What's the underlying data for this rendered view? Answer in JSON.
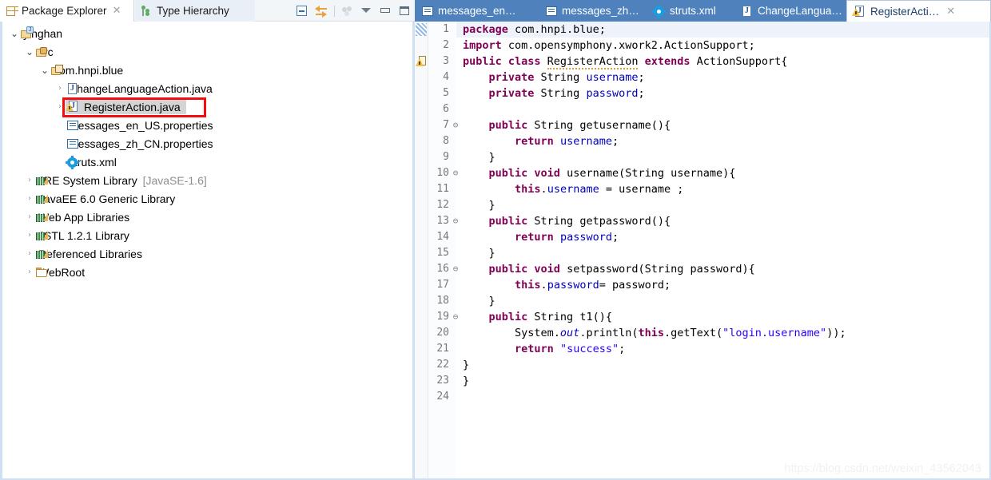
{
  "left_view": {
    "tabs": [
      {
        "label": "Package Explorer",
        "icon": "package-explorer-icon",
        "active": true,
        "close": "✕"
      },
      {
        "label": "Type Hierarchy",
        "icon": "type-hierarchy-icon",
        "active": false
      }
    ],
    "toolbar": [
      {
        "name": "collapse-all-icon",
        "title": "Collapse All"
      },
      {
        "name": "link-with-editor-icon",
        "title": "Link with Editor"
      },
      {
        "name": "view-menu-icon",
        "title": "View Menu"
      },
      {
        "name": "chevron-down-icon",
        "title": "Restore"
      },
      {
        "name": "minimize-icon",
        "title": "Minimize"
      },
      {
        "name": "maximize-icon",
        "title": "Maximize"
      }
    ],
    "tree": [
      {
        "label": "yinghan",
        "icon": "java-project-icon",
        "indent": 0,
        "twisty": "open",
        "selected": false
      },
      {
        "label": "src",
        "icon": "source-folder-icon",
        "indent": 1,
        "twisty": "open",
        "selected": false
      },
      {
        "label": "com.hnpi.blue",
        "icon": "package-icon",
        "indent": 2,
        "twisty": "open",
        "selected": false
      },
      {
        "label": "ChangeLanguageAction.java",
        "icon": "java-file-icon",
        "indent": 3,
        "twisty": "closed",
        "selected": false
      },
      {
        "label": "RegisterAction.java",
        "icon": "java-file-warning-icon",
        "indent": 3,
        "twisty": "closed",
        "selected": true,
        "annotated": true
      },
      {
        "label": "messages_en_US.properties",
        "icon": "properties-file-icon",
        "indent": 3,
        "twisty": "none",
        "selected": false
      },
      {
        "label": "messages_zh_CN.properties",
        "icon": "properties-file-icon",
        "indent": 3,
        "twisty": "none",
        "selected": false
      },
      {
        "label": "struts.xml",
        "icon": "xml-config-icon",
        "indent": 3,
        "twisty": "none",
        "selected": false
      },
      {
        "label": "JRE System Library",
        "suffix": " [JavaSE-1.6]",
        "icon": "library-icon",
        "indent": 1,
        "twisty": "closed",
        "selected": false
      },
      {
        "label": "JavaEE 6.0 Generic Library",
        "icon": "library-icon",
        "indent": 1,
        "twisty": "closed",
        "selected": false
      },
      {
        "label": "Web App Libraries",
        "icon": "library-icon",
        "indent": 1,
        "twisty": "closed",
        "selected": false
      },
      {
        "label": "JSTL 1.2.1 Library",
        "icon": "library-icon",
        "indent": 1,
        "twisty": "closed",
        "selected": false
      },
      {
        "label": "Referenced Libraries",
        "icon": "library-icon",
        "indent": 1,
        "twisty": "closed",
        "selected": false
      },
      {
        "label": "WebRoot",
        "icon": "folder-icon",
        "indent": 1,
        "twisty": "closed",
        "selected": false
      }
    ]
  },
  "editor": {
    "tabs": [
      {
        "label": "messages_en…",
        "icon": "properties-file-icon",
        "active": false
      },
      {
        "label": "messages_zh…",
        "icon": "properties-file-icon",
        "active": false
      },
      {
        "label": "struts.xml",
        "icon": "xml-config-icon",
        "active": false
      },
      {
        "label": "ChangeLangua…",
        "icon": "java-file-icon",
        "active": false
      },
      {
        "label": "RegisterActi…",
        "icon": "java-file-warning-icon",
        "active": true,
        "close": "✕"
      }
    ],
    "lines": [
      {
        "n": "1",
        "fold": "",
        "current": true,
        "marker": "unsaved",
        "tokens": [
          {
            "t": "package ",
            "c": "kw"
          },
          {
            "t": "com.hnpi.blue;",
            "c": ""
          }
        ]
      },
      {
        "n": "2",
        "fold": "",
        "current": false,
        "marker": "",
        "tokens": [
          {
            "t": "import ",
            "c": "kw"
          },
          {
            "t": "com.opensymphony.xwork2.ActionSupport;",
            "c": ""
          }
        ]
      },
      {
        "n": "3",
        "fold": "",
        "current": false,
        "marker": "warning",
        "tokens": [
          {
            "t": "public class ",
            "c": "kw"
          },
          {
            "t": "RegisterAction",
            "c": "squig"
          },
          {
            "t": " ",
            "c": ""
          },
          {
            "t": "extends ",
            "c": "kw"
          },
          {
            "t": "ActionSupport{",
            "c": ""
          }
        ]
      },
      {
        "n": "4",
        "fold": "",
        "current": false,
        "marker": "",
        "tokens": [
          {
            "t": "    ",
            "c": ""
          },
          {
            "t": "private ",
            "c": "kw"
          },
          {
            "t": "String ",
            "c": ""
          },
          {
            "t": "username",
            "c": "fld"
          },
          {
            "t": ";",
            "c": ""
          }
        ]
      },
      {
        "n": "5",
        "fold": "",
        "current": false,
        "marker": "",
        "tokens": [
          {
            "t": "    ",
            "c": ""
          },
          {
            "t": "private ",
            "c": "kw"
          },
          {
            "t": "String ",
            "c": ""
          },
          {
            "t": "password",
            "c": "fld"
          },
          {
            "t": ";",
            "c": ""
          }
        ]
      },
      {
        "n": "6",
        "fold": "",
        "current": false,
        "marker": "",
        "tokens": [
          {
            "t": "",
            "c": ""
          }
        ]
      },
      {
        "n": "7",
        "fold": "⊖",
        "current": false,
        "marker": "",
        "tokens": [
          {
            "t": "    ",
            "c": ""
          },
          {
            "t": "public ",
            "c": "kw"
          },
          {
            "t": "String getusername(){",
            "c": ""
          }
        ]
      },
      {
        "n": "8",
        "fold": "",
        "current": false,
        "marker": "",
        "tokens": [
          {
            "t": "        ",
            "c": ""
          },
          {
            "t": "return ",
            "c": "kw"
          },
          {
            "t": "username",
            "c": "fld"
          },
          {
            "t": ";",
            "c": ""
          }
        ]
      },
      {
        "n": "9",
        "fold": "",
        "current": false,
        "marker": "",
        "tokens": [
          {
            "t": "    }",
            "c": ""
          }
        ]
      },
      {
        "n": "10",
        "fold": "⊖",
        "current": false,
        "marker": "",
        "tokens": [
          {
            "t": "    ",
            "c": ""
          },
          {
            "t": "public void ",
            "c": "kw"
          },
          {
            "t": "username(String username){",
            "c": ""
          }
        ]
      },
      {
        "n": "11",
        "fold": "",
        "current": false,
        "marker": "",
        "tokens": [
          {
            "t": "        ",
            "c": ""
          },
          {
            "t": "this",
            "c": "kw"
          },
          {
            "t": ".",
            "c": ""
          },
          {
            "t": "username",
            "c": "fld"
          },
          {
            "t": " = username ;",
            "c": ""
          }
        ]
      },
      {
        "n": "12",
        "fold": "",
        "current": false,
        "marker": "",
        "tokens": [
          {
            "t": "    }",
            "c": ""
          }
        ]
      },
      {
        "n": "13",
        "fold": "⊖",
        "current": false,
        "marker": "",
        "tokens": [
          {
            "t": "    ",
            "c": ""
          },
          {
            "t": "public ",
            "c": "kw"
          },
          {
            "t": "String getpassword(){",
            "c": ""
          }
        ]
      },
      {
        "n": "14",
        "fold": "",
        "current": false,
        "marker": "",
        "tokens": [
          {
            "t": "        ",
            "c": ""
          },
          {
            "t": "return ",
            "c": "kw"
          },
          {
            "t": "password",
            "c": "fld"
          },
          {
            "t": ";",
            "c": ""
          }
        ]
      },
      {
        "n": "15",
        "fold": "",
        "current": false,
        "marker": "",
        "tokens": [
          {
            "t": "    }",
            "c": ""
          }
        ]
      },
      {
        "n": "16",
        "fold": "⊖",
        "current": false,
        "marker": "",
        "tokens": [
          {
            "t": "    ",
            "c": ""
          },
          {
            "t": "public void ",
            "c": "kw"
          },
          {
            "t": "setpassword(String password){",
            "c": ""
          }
        ]
      },
      {
        "n": "17",
        "fold": "",
        "current": false,
        "marker": "",
        "tokens": [
          {
            "t": "        ",
            "c": ""
          },
          {
            "t": "this",
            "c": "kw"
          },
          {
            "t": ".",
            "c": ""
          },
          {
            "t": "password",
            "c": "fld"
          },
          {
            "t": "= password;",
            "c": ""
          }
        ]
      },
      {
        "n": "18",
        "fold": "",
        "current": false,
        "marker": "",
        "tokens": [
          {
            "t": "    }",
            "c": ""
          }
        ]
      },
      {
        "n": "19",
        "fold": "⊖",
        "current": false,
        "marker": "",
        "tokens": [
          {
            "t": "    ",
            "c": ""
          },
          {
            "t": "public ",
            "c": "kw"
          },
          {
            "t": "String t1(){",
            "c": ""
          }
        ]
      },
      {
        "n": "20",
        "fold": "",
        "current": false,
        "marker": "",
        "tokens": [
          {
            "t": "        System.",
            "c": ""
          },
          {
            "t": "out",
            "c": "stat"
          },
          {
            "t": ".println(",
            "c": ""
          },
          {
            "t": "this",
            "c": "kw"
          },
          {
            "t": ".getText(",
            "c": ""
          },
          {
            "t": "\"login.username\"",
            "c": "str"
          },
          {
            "t": "));",
            "c": ""
          }
        ]
      },
      {
        "n": "21",
        "fold": "",
        "current": false,
        "marker": "",
        "tokens": [
          {
            "t": "        ",
            "c": ""
          },
          {
            "t": "return ",
            "c": "kw"
          },
          {
            "t": "\"success\"",
            "c": "str"
          },
          {
            "t": ";",
            "c": ""
          }
        ]
      },
      {
        "n": "22",
        "fold": "",
        "current": false,
        "marker": "",
        "tokens": [
          {
            "t": "}",
            "c": ""
          }
        ]
      },
      {
        "n": "23",
        "fold": "",
        "current": false,
        "marker": "",
        "tokens": [
          {
            "t": "}",
            "c": ""
          }
        ]
      },
      {
        "n": "24",
        "fold": "",
        "current": false,
        "marker": "",
        "tokens": [
          {
            "t": "",
            "c": ""
          }
        ]
      }
    ]
  },
  "watermark": "https://blog.csdn.net/weixin_43562043",
  "colors": {
    "tab_active_editor_bg": "#ffffff",
    "tab_bar_editor_bg": "#4f81bd",
    "keyword": "#7f0055",
    "string": "#2a00ff",
    "field": "#0000c0",
    "annotation_box": "#f40d10",
    "selection": "#d4d4d4",
    "current_line": "#eef3fb"
  }
}
